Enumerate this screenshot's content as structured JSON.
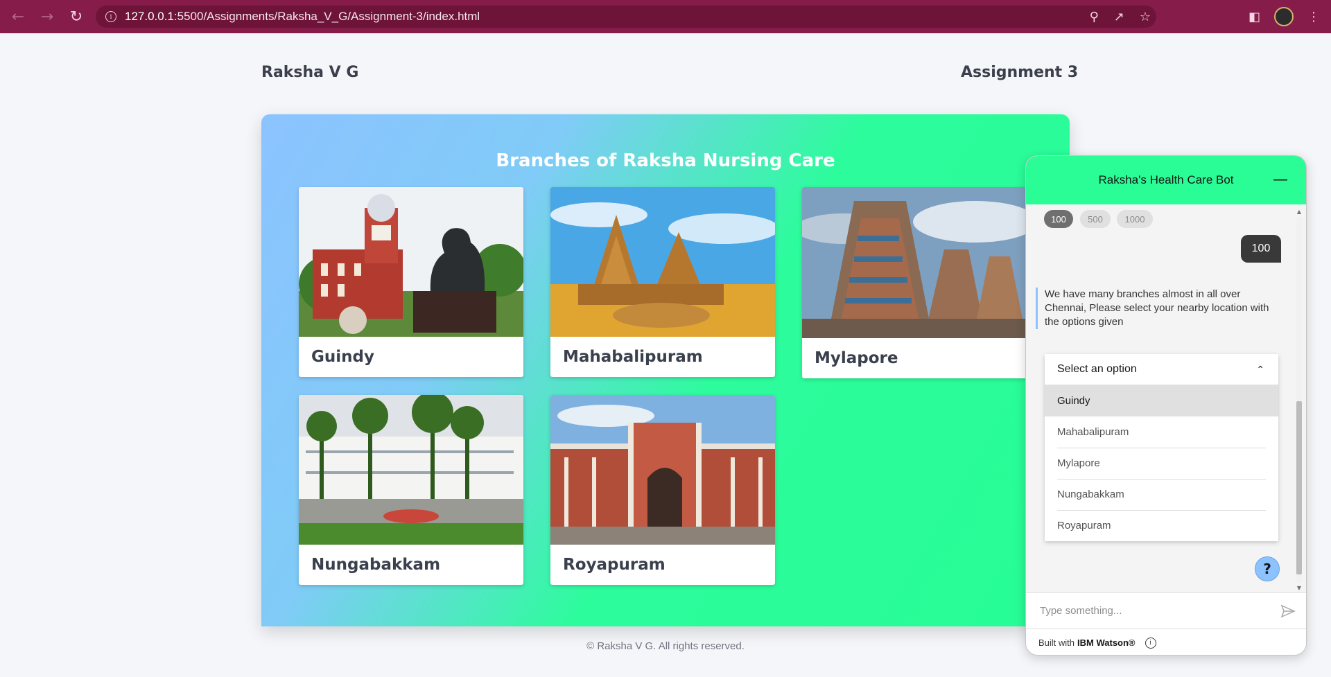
{
  "browser": {
    "url_host": "127.0.0.1",
    "url_rest": ":5500/Assignments/Raksha_V_G/Assignment-3/index.html",
    "info_icon": "info-icon",
    "theme_color": "#861c4a"
  },
  "header": {
    "brand": "Raksha V G",
    "assignment": "Assignment 3"
  },
  "hero": {
    "title": "Branches of Raksha Nursing Care",
    "gradient_start": "#8cc3ff",
    "gradient_end": "#26fd96",
    "branches": [
      {
        "label": "Guindy"
      },
      {
        "label": "Mahabalipuram"
      },
      {
        "label": "Mylapore"
      },
      {
        "label": "Nungabakkam"
      },
      {
        "label": "Royapuram"
      }
    ]
  },
  "chat": {
    "title": "Raksha's Health Care Bot",
    "chips": [
      "100",
      "500",
      "1000"
    ],
    "user_message": "100",
    "bot_message": "We have many branches almost in all over Chennai, Please select your nearby location with the options given",
    "dropdown": {
      "placeholder": "Select an option",
      "options": [
        "Guindy",
        "Mahabalipuram",
        "Mylapore",
        "Nungabakkam",
        "Royapuram"
      ],
      "highlighted": "Guindy"
    },
    "help_label": "?",
    "input_placeholder": "Type something...",
    "footer_prefix": "Built with",
    "footer_brand": "IBM Watson®",
    "header_color": "#2afc96"
  },
  "footer": {
    "copyright": "© Raksha V G. All rights reserved."
  }
}
